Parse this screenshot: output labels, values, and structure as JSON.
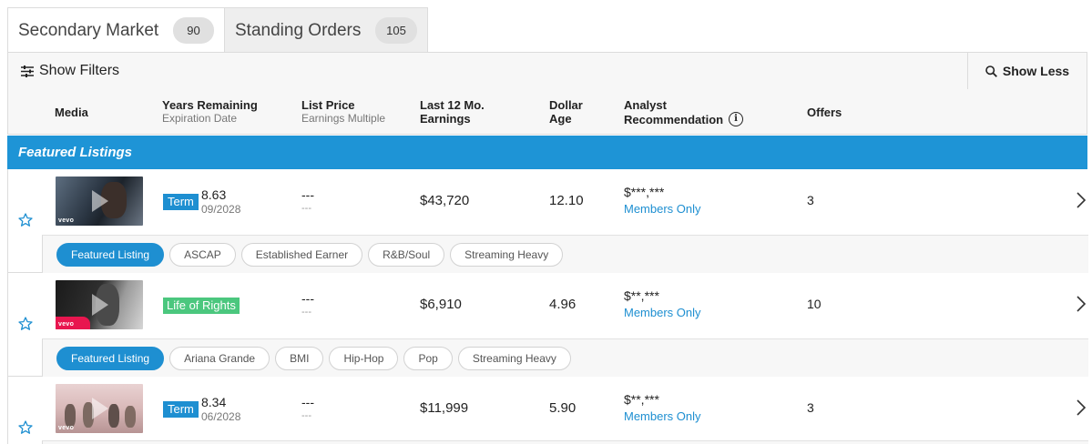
{
  "tabs": [
    {
      "label": "Secondary Market",
      "count": "90"
    },
    {
      "label": "Standing Orders",
      "count": "105"
    }
  ],
  "filterbar": {
    "show_filters": "Show Filters",
    "show_less": "Show Less"
  },
  "columns": {
    "media": "Media",
    "years": "Years Remaining",
    "years_sub": "Expiration Date",
    "price": "List Price",
    "price_sub": "Earnings Multiple",
    "earn_1": "Last 12 Mo.",
    "earn_2": "Earnings",
    "dollar_1": "Dollar",
    "dollar_2": "Age",
    "analyst_1": "Analyst",
    "analyst_2": "Recommendation",
    "offers": "Offers"
  },
  "featured_band": "Featured Listings",
  "listings": [
    {
      "badge": "Term",
      "years": "8.63",
      "expiration": "09/2028",
      "price": "---",
      "multiple": "---",
      "earnings": "$43,720",
      "dollar_age": "12.10",
      "analyst": "$***,***",
      "members": "Members Only",
      "offers": "3",
      "thumb_label": "vevo",
      "tags": [
        "Featured Listing",
        "ASCAP",
        "Established Earner",
        "R&B/Soul",
        "Streaming Heavy"
      ]
    },
    {
      "badge": "Life of Rights",
      "years": "",
      "expiration": "",
      "price": "---",
      "multiple": "---",
      "earnings": "$6,910",
      "dollar_age": "4.96",
      "analyst": "$**,***",
      "members": "Members Only",
      "offers": "10",
      "thumb_label": "vevo",
      "tags": [
        "Featured Listing",
        "Ariana Grande",
        "BMI",
        "Hip-Hop",
        "Pop",
        "Streaming Heavy"
      ]
    },
    {
      "badge": "Term",
      "years": "8.34",
      "expiration": "06/2028",
      "price": "---",
      "multiple": "---",
      "earnings": "$11,999",
      "dollar_age": "5.90",
      "analyst": "$**,***",
      "members": "Members Only",
      "offers": "3",
      "thumb_label": "vevo",
      "tags": []
    }
  ],
  "colors": {
    "accent": "#1e8fd1",
    "band": "#1e94d6",
    "life_of_rights": "#4bc77e"
  }
}
